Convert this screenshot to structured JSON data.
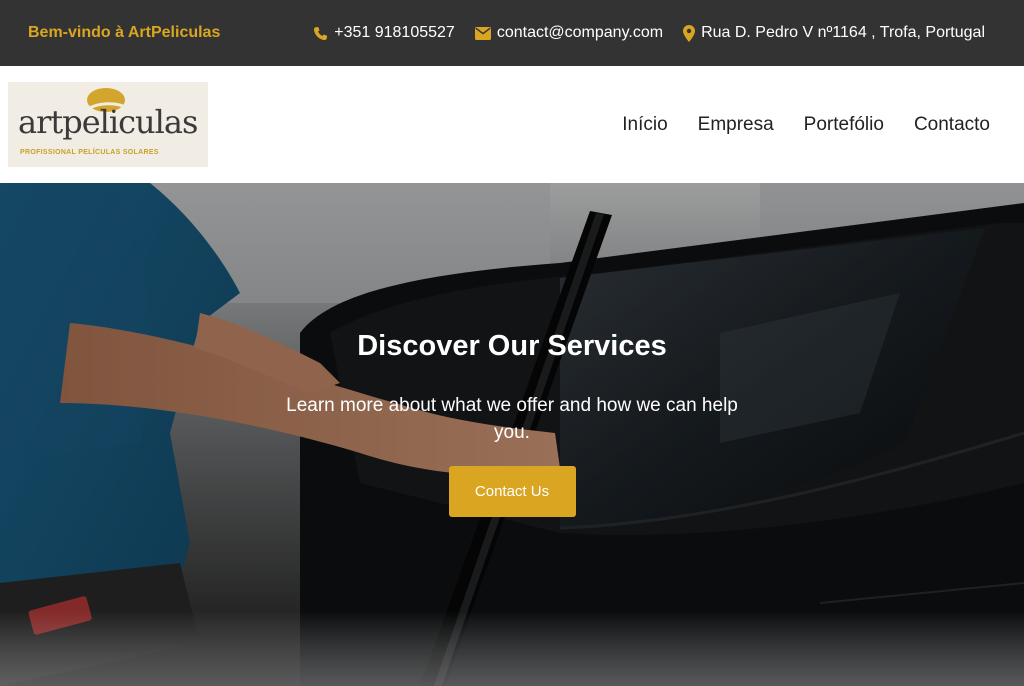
{
  "topbar": {
    "welcome": "Bem-vindo à ArtPeliculas",
    "phone": {
      "icon": "phone-icon",
      "text": "+351 918105527"
    },
    "email": {
      "icon": "envelope-icon",
      "text": "contact@company.com"
    },
    "address": {
      "icon": "map-pin-icon",
      "text": "Rua D. Pedro V nº1164 , Trofa, Portugal"
    }
  },
  "header": {
    "logo": {
      "name": "artpeliculas",
      "tagline": "PROFISSIONAL PELÍCULAS SOLARES"
    },
    "nav": [
      {
        "label": "Início"
      },
      {
        "label": "Empresa"
      },
      {
        "label": "Portefólio"
      },
      {
        "label": "Contacto"
      }
    ]
  },
  "hero": {
    "title": "Discover Our Services",
    "subtitle": "Learn more about what we offer and how we can help you.",
    "cta_label": "Contact Us"
  },
  "colors": {
    "accent": "#DAA520",
    "topbar_bg": "#333333",
    "header_bg": "#FFFFFF"
  }
}
